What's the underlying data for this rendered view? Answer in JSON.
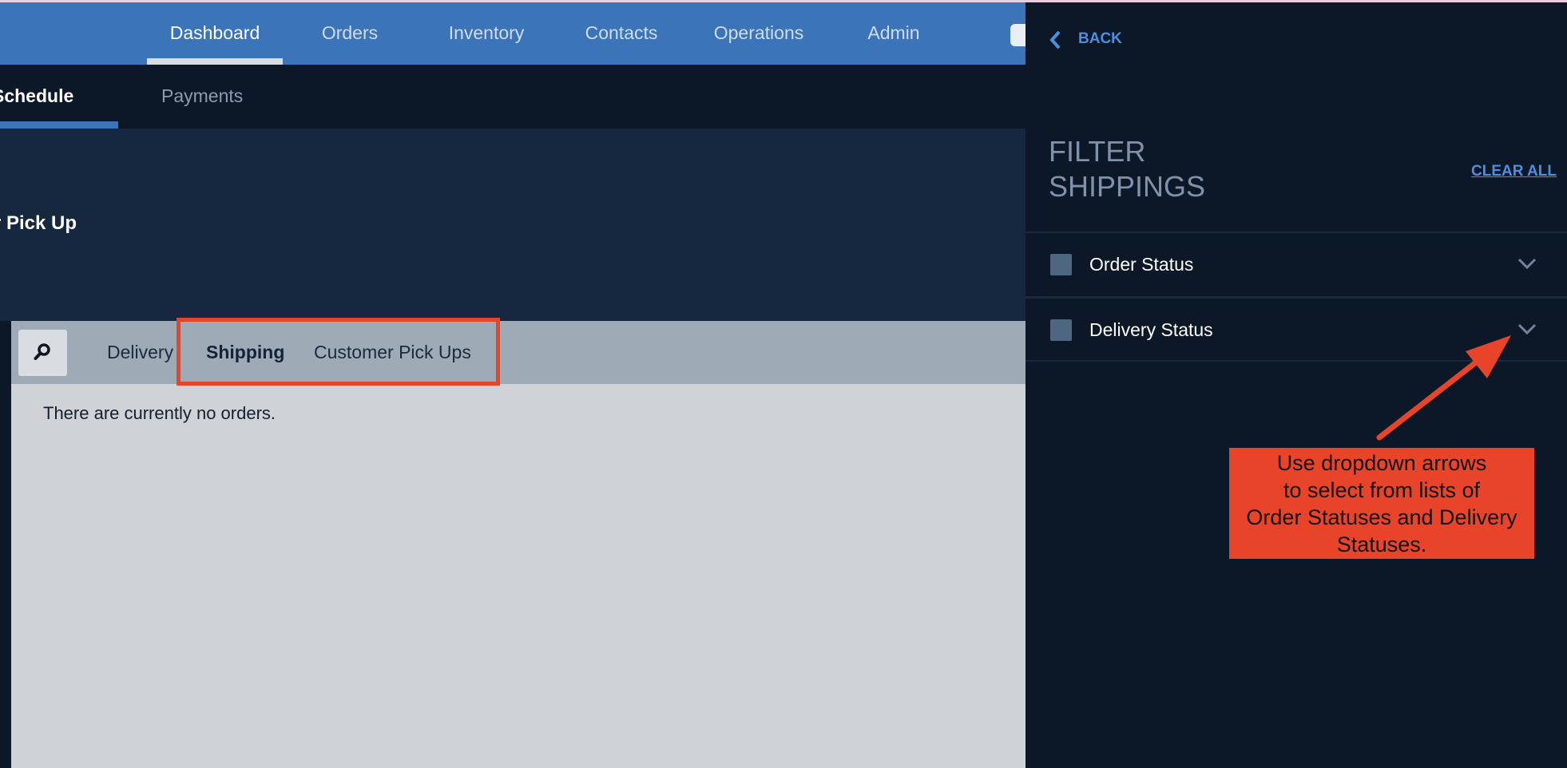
{
  "topnav": {
    "items": [
      {
        "label": "Dashboard",
        "active": true
      },
      {
        "label": "Orders",
        "active": false
      },
      {
        "label": "Inventory",
        "active": false
      },
      {
        "label": "Contacts",
        "active": false
      },
      {
        "label": "Operations",
        "active": false
      },
      {
        "label": "Admin",
        "active": false
      }
    ]
  },
  "subnav": {
    "tabs": [
      {
        "label": "Schedule",
        "active": true
      },
      {
        "label": "Payments",
        "active": false
      }
    ]
  },
  "header": {
    "title": "r Pick Up"
  },
  "toolbar": {
    "search_icon": "search-icon",
    "tabs": [
      {
        "label": "Delivery",
        "selected": false
      },
      {
        "label": "Shipping",
        "selected": true
      },
      {
        "label": "Customer Pick Ups",
        "selected": false
      }
    ]
  },
  "main": {
    "empty_message": "There are currently no orders."
  },
  "panel": {
    "back_label": "BACK",
    "title_line1": "FILTER",
    "title_line2": "SHIPPINGS",
    "clear_all_label": "CLEAR ALL",
    "filters": [
      {
        "label": "Order Status",
        "checked": false
      },
      {
        "label": "Delivery Status",
        "checked": false
      }
    ]
  },
  "annotation": {
    "callout_line1": "Use dropdown arrows",
    "callout_line2": "to select from lists of",
    "callout_line3": "Order Statuses and Delivery",
    "callout_line4": "Statuses."
  },
  "colors": {
    "nav_blue": "#3b74b8",
    "panel_bg": "#0c1828",
    "accent_link": "#4a90e2",
    "annotation_red": "#e8442a"
  }
}
